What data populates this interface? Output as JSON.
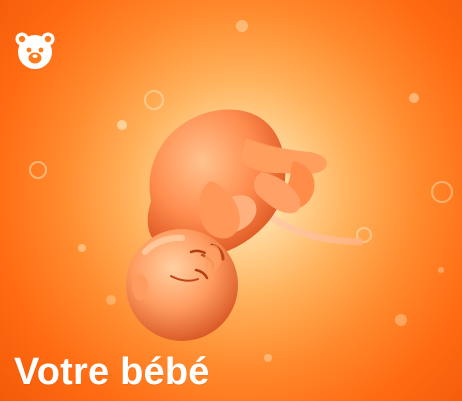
{
  "app": {
    "icon": "bear-face-icon",
    "accent_color": "#ff7a1a"
  },
  "hero": {
    "title": "Votre bébé",
    "illustration": "fetus-illustration"
  }
}
